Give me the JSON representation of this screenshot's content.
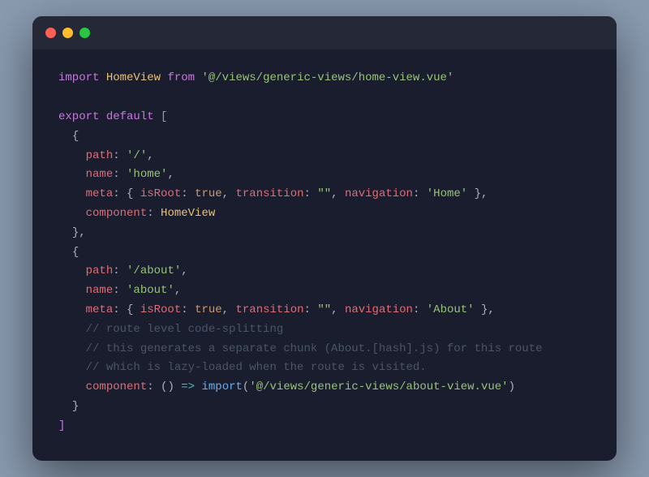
{
  "window": {
    "titlebar": {
      "dot_red": "close",
      "dot_yellow": "minimize",
      "dot_green": "maximize"
    }
  },
  "code": {
    "lines": [
      {
        "id": 1,
        "content": "import HomeView from '@/views/generic-views/home-view.vue'"
      },
      {
        "id": 2,
        "content": ""
      },
      {
        "id": 3,
        "content": "export default ["
      },
      {
        "id": 4,
        "content": "  {"
      },
      {
        "id": 5,
        "content": "    path: '/',"
      },
      {
        "id": 6,
        "content": "    name: 'home',"
      },
      {
        "id": 7,
        "content": "    meta: { isRoot: true, transition: \"\", navigation: 'Home' },"
      },
      {
        "id": 8,
        "content": "    component: HomeView"
      },
      {
        "id": 9,
        "content": "  },"
      },
      {
        "id": 10,
        "content": "  {"
      },
      {
        "id": 11,
        "content": "    path: '/about',"
      },
      {
        "id": 12,
        "content": "    name: 'about',"
      },
      {
        "id": 13,
        "content": "    meta: { isRoot: true, transition: \"\", navigation: 'About' },"
      },
      {
        "id": 14,
        "content": "    // route level code-splitting"
      },
      {
        "id": 15,
        "content": "    // this generates a separate chunk (About.[hash].js) for this route"
      },
      {
        "id": 16,
        "content": "    // which is lazy-loaded when the route is visited."
      },
      {
        "id": 17,
        "content": "    component: () => import('@/views/generic-views/about-view.vue')"
      },
      {
        "id": 18,
        "content": "  }"
      },
      {
        "id": 19,
        "content": "]"
      }
    ]
  }
}
